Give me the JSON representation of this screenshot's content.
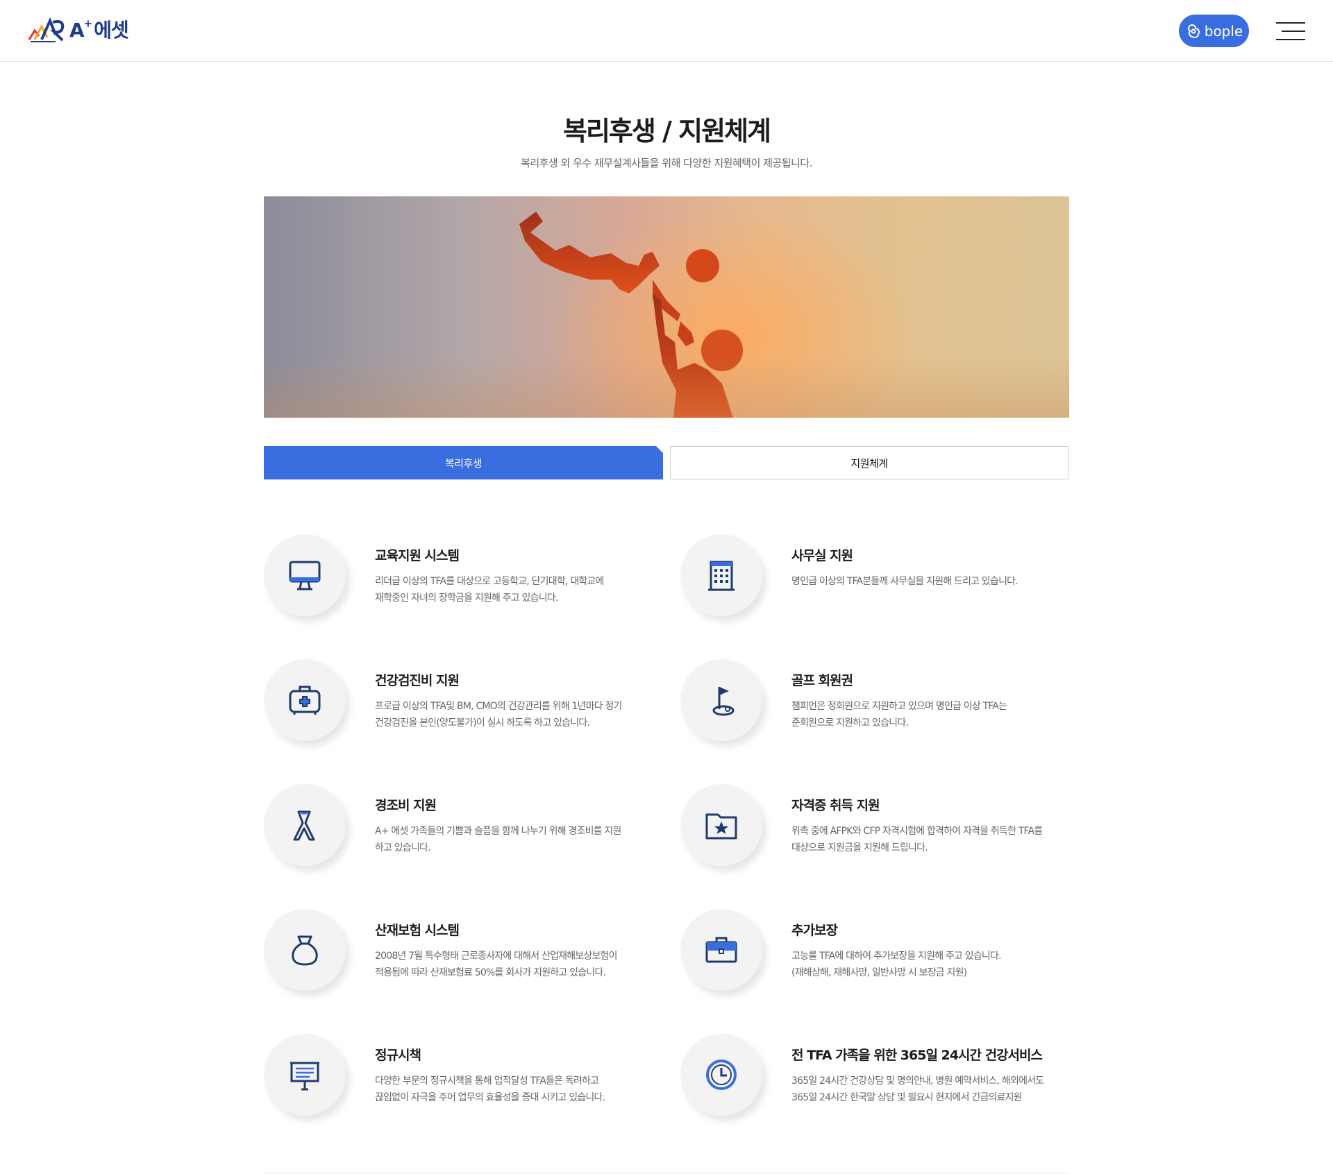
{
  "header": {
    "logo_text": "에셋",
    "logo_mark": "A",
    "logo_sup": "+",
    "bople_label": "bople"
  },
  "page": {
    "title": "복리후생 / 지원체계",
    "subtitle": "복리후생 외 우수 재무설계사들을 위해 다양한 지원혜택이 제공됩니다."
  },
  "tabs": [
    {
      "label": "복리후생",
      "active": true
    },
    {
      "label": "지원체계",
      "active": false
    }
  ],
  "colors": {
    "accent": "#3a6ee0",
    "icon_navy": "#1f3b6e",
    "icon_blue": "#3a6ee0"
  },
  "benefits": [
    {
      "icon": "monitor-icon",
      "title": "교육지원 시스템",
      "desc": [
        "리더급 이상의 TFA를 대상으로 고등학교, 단기대학, 대학교에",
        "재학중인 자녀의 장학금을 지원해 주고 있습니다."
      ]
    },
    {
      "icon": "building-icon",
      "title": "사무실 지원",
      "desc": [
        "명인급 이상의 TFA분들께 사무실을 지원해 드리고 있습니다."
      ]
    },
    {
      "icon": "medical-kit-icon",
      "title": "건강검진비 지원",
      "desc": [
        "프로급 이상의 TFA및 BM, CMO의 건강관리를 위해 1년마다 정기",
        "건강검진을 본인(양도불가)이 실시 하도록 하고 있습니다."
      ]
    },
    {
      "icon": "golf-flag-icon",
      "title": "골프 회원권",
      "desc": [
        "챔피언은 정회원으로 지원하고 있으며 명인급 이상 TFA는",
        "준회원으로 지원하고 있습니다."
      ]
    },
    {
      "icon": "ribbon-icon",
      "title": "경조비 지원",
      "desc": [
        "A+ 에셋 가족들의 기쁨과 슬픔을 함께 나누기 위해 경조비를 지원",
        "하고 있습니다."
      ]
    },
    {
      "icon": "star-folder-icon",
      "title": "자격증 취득 지원",
      "desc": [
        "위촉 중에 AFPK와 CFP 자격시험에 합격하여 자격을 취득한 TFA를",
        "대상으로 지원금을 지원해 드립니다."
      ]
    },
    {
      "icon": "money-bag-icon",
      "title": "산재보험 시스템",
      "desc": [
        "2008년 7월 특수형태 근로종사자에 대해서 산업재해보상보험이",
        "적용됨에 따라 산재보험료 50%를 회사가 지원하고 있습니다."
      ]
    },
    {
      "icon": "briefcase-icon",
      "title": "추가보장",
      "desc": [
        "고능률 TFA에 대하여 추가보장을 지원해 주고 있습니다.",
        "(재해상해, 재해사망, 일반사망 시 보장금 지원)"
      ]
    },
    {
      "icon": "presentation-board-icon",
      "title": "정규시책",
      "desc": [
        "다양한 부문의 정규시책을 통해 업적달성 TFA들은 독려하고",
        "끊임없이 자극을 주어 업무의 효율성을 증대 시키고 있습니다."
      ]
    },
    {
      "icon": "clock-icon",
      "title": "전 TFA 가족을 위한 365일 24시간 건강서비스",
      "desc": [
        "365일 24시간 건강상담 및 명의안내, 병원 예약서비스, 해외에서도",
        "365일 24시간 한국말 상담 및 필요시 현지에서 긴급의료지원"
      ]
    }
  ]
}
